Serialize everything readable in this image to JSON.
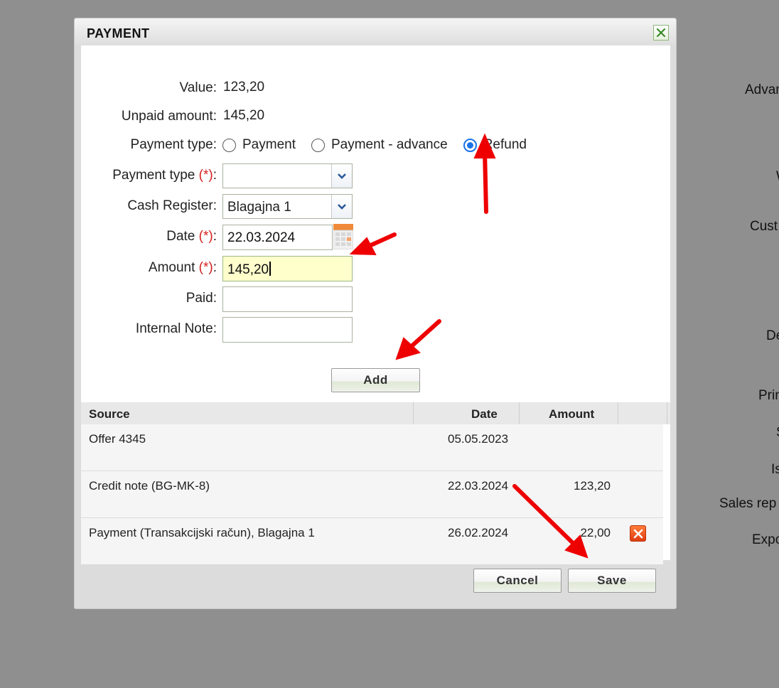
{
  "background": {
    "labels": [
      "Advan",
      "W",
      "Cust",
      "De",
      "Prin",
      "S",
      "Is",
      "Sales rep",
      "Expo"
    ]
  },
  "dialog": {
    "title": "PAYMENT",
    "close_icon": "close-icon"
  },
  "form": {
    "value_label": "Value:",
    "value": "123,20",
    "unpaid_label": "Unpaid amount:",
    "unpaid": "145,20",
    "payment_type_label": "Payment type:",
    "payment_type_options": [
      "Payment",
      "Payment - advance",
      "Refund"
    ],
    "payment_type_selected": "Refund",
    "payment_method_label": "Payment type",
    "required_mark": "(*)",
    "colon": ":",
    "payment_method_value": "",
    "cash_register_label": "Cash Register:",
    "cash_register_value": "Blagajna 1",
    "date_label": "Date",
    "date_value": "22.03.2024",
    "amount_label": "Amount",
    "amount_value": "145,20",
    "paid_label": "Paid:",
    "paid_value": "",
    "note_label": "Internal Note:",
    "note_value": "",
    "add_button": "Add"
  },
  "table": {
    "columns": [
      "Source",
      "Date",
      "Amount"
    ],
    "rows": [
      {
        "source": "Offer 4345",
        "date": "05.05.2023",
        "amount": "",
        "deletable": false
      },
      {
        "source": "Credit note (BG-MK-8)",
        "date": "22.03.2024",
        "amount": "123,20",
        "deletable": false
      },
      {
        "source": "Payment (Transakcijski račun), Blagajna 1",
        "date": "26.02.2024",
        "amount": "22,00",
        "deletable": true
      }
    ]
  },
  "footer": {
    "cancel_button": "Cancel",
    "save_button": "Save"
  },
  "colors": {
    "accent": "#1a73e8",
    "required": "#d42020",
    "highlight_field": "#ffffcc",
    "annotation_arrow": "#ee0000"
  }
}
